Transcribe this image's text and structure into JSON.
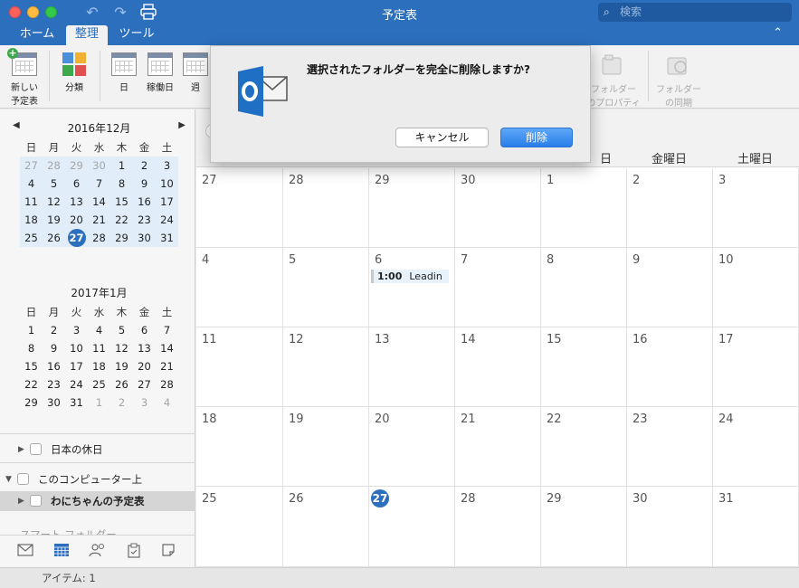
{
  "window": {
    "title": "予定表",
    "search_placeholder": "検索",
    "search_icon": "search-icon",
    "undo_icon": "undo-icon",
    "redo_icon": "redo-icon",
    "print_icon": "print-icon",
    "collapse_icon": "chevron-up-icon"
  },
  "tabs": [
    {
      "label": "ホーム"
    },
    {
      "label": "整理",
      "active": true
    },
    {
      "label": "ツール"
    }
  ],
  "ribbon": {
    "new_calendar": "新しい\n予定表",
    "new_calendar_line1": "新しい",
    "new_calendar_line2": "予定表",
    "categorize": "分類",
    "day": "日",
    "work_week": "稼働日",
    "week": "週",
    "folder_properties_line1": "フォルダー",
    "folder_properties_line2": "のプロパティ",
    "folder_sync_line1": "フォルダー",
    "folder_sync_line2": "の同期"
  },
  "mini_calendars": [
    {
      "title": "2016年12月",
      "weekdays": [
        "日",
        "月",
        "火",
        "水",
        "木",
        "金",
        "土"
      ],
      "days": [
        "27",
        "28",
        "29",
        "30",
        "1",
        "2",
        "3",
        "4",
        "5",
        "6",
        "7",
        "8",
        "9",
        "10",
        "11",
        "12",
        "13",
        "14",
        "15",
        "16",
        "17",
        "18",
        "19",
        "20",
        "21",
        "22",
        "23",
        "24",
        "25",
        "26",
        "27",
        "28",
        "29",
        "30",
        "31"
      ],
      "today": "27"
    },
    {
      "title": "2017年1月",
      "weekdays": [
        "日",
        "月",
        "火",
        "水",
        "木",
        "金",
        "土"
      ],
      "days": [
        "1",
        "2",
        "3",
        "4",
        "5",
        "6",
        "7",
        "8",
        "9",
        "10",
        "11",
        "12",
        "13",
        "14",
        "15",
        "16",
        "17",
        "18",
        "19",
        "20",
        "21",
        "22",
        "23",
        "24",
        "25",
        "26",
        "27",
        "28",
        "29",
        "30",
        "31",
        "1",
        "2",
        "3",
        "4"
      ]
    }
  ],
  "folders": {
    "holidays": "日本の休日",
    "on_my_computer": "このコンピューター上",
    "my_calendar": "わにちゃんの予定表",
    "smart_folders": "スマート フォルダー"
  },
  "calendar": {
    "day_headers": [
      "日",
      "金曜日",
      "土曜日"
    ],
    "weeks": [
      [
        "27",
        "28",
        "29",
        "30",
        "1",
        "2",
        "3"
      ],
      [
        "4",
        "5",
        "6",
        "7",
        "8",
        "9",
        "10"
      ],
      [
        "11",
        "12",
        "13",
        "14",
        "15",
        "16",
        "17"
      ],
      [
        "18",
        "19",
        "20",
        "21",
        "22",
        "23",
        "24"
      ],
      [
        "25",
        "26",
        "27",
        "28",
        "29",
        "30",
        "31"
      ]
    ],
    "today": "27",
    "event": {
      "time": "1:00",
      "title": "Leadin"
    }
  },
  "status": {
    "items": "アイテム: 1"
  },
  "dialog": {
    "message": "選択されたフォルダーを完全に削除しますか?",
    "cancel": "キャンセル",
    "delete": "削除",
    "icon": "outlook-icon"
  },
  "colors": {
    "accent": "#2c6fbd",
    "primary_button": "#2a7ee8"
  }
}
